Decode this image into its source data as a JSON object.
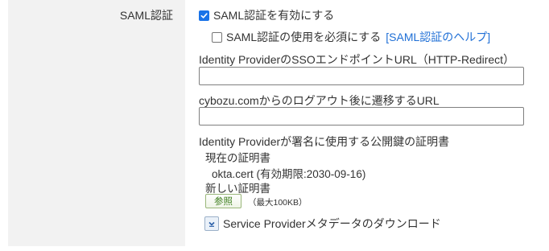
{
  "section": {
    "label": "SAML認証"
  },
  "enable_saml": {
    "label": "SAML認証を有効にする",
    "checked": true
  },
  "require_saml": {
    "label": "SAML認証の使用を必須にする",
    "checked": false,
    "help_link": "[SAML認証のヘルプ]"
  },
  "sso_url": {
    "label": "Identity ProviderのSSOエンドポイントURL（HTTP-Redirect）",
    "value": ""
  },
  "logout_url": {
    "label": "cybozu.comからのログアウト後に遷移するURL",
    "value": ""
  },
  "certificate": {
    "label": "Identity Providerが署名に使用する公開鍵の証明書",
    "current_label": "現在の証明書",
    "current_value": "okta.cert (有効期限:2030-09-16)",
    "new_label": "新しい証明書",
    "browse_button": "参照",
    "max_size": "（最大100KB）"
  },
  "sp_metadata": {
    "download_label": "Service Providerメタデータのダウンロード",
    "icon": "download-icon"
  },
  "colors": {
    "checkbox_checked": "#1a73e8",
    "link": "#1f6fd6",
    "label_panel": "#f2f2f2",
    "browse_button_text": "#3f7f1f"
  }
}
